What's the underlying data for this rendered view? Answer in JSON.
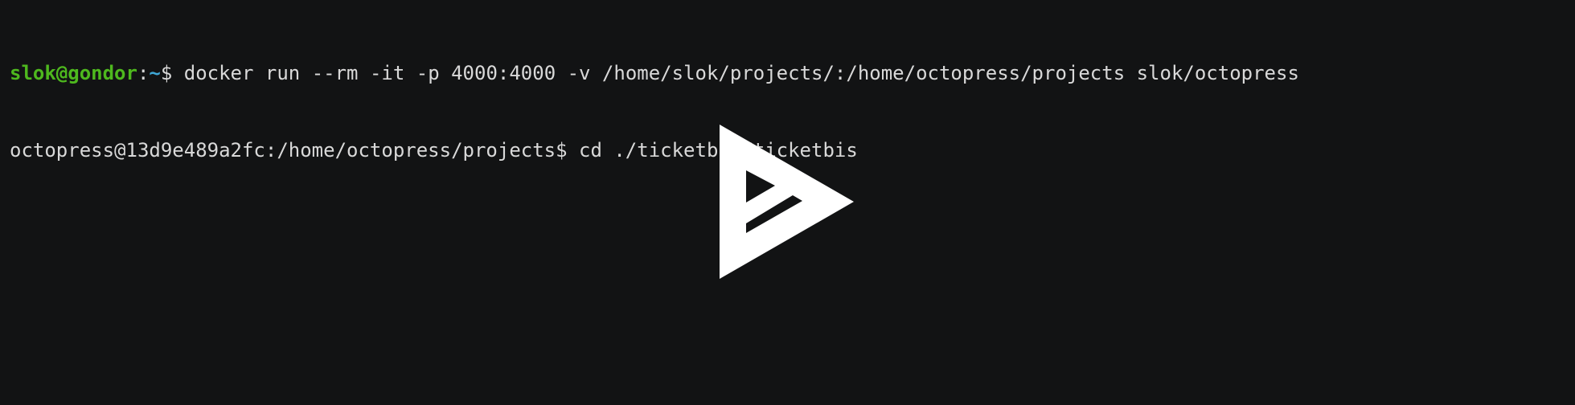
{
  "terminal": {
    "lines": [
      {
        "user_host": "slok@gondor",
        "colon": ":",
        "cwd": "~",
        "prompt_symbol": "$",
        "command": " docker run --rm -it -p 4000:4000 -v /home/slok/projects/:/home/octopress/projects slok/octopress"
      },
      {
        "prompt": "octopress@13d9e489a2fc:/home/octopress/projects$",
        "command": " cd ./ticketbis/ticketbis"
      }
    ]
  },
  "player": {
    "icon": "asciinema-play-icon"
  },
  "colors": {
    "background": "#121314",
    "text": "#d9d9d9",
    "user_host": "#4eb81e",
    "cwd": "#3fa7d6",
    "play_icon": "#ffffff"
  }
}
